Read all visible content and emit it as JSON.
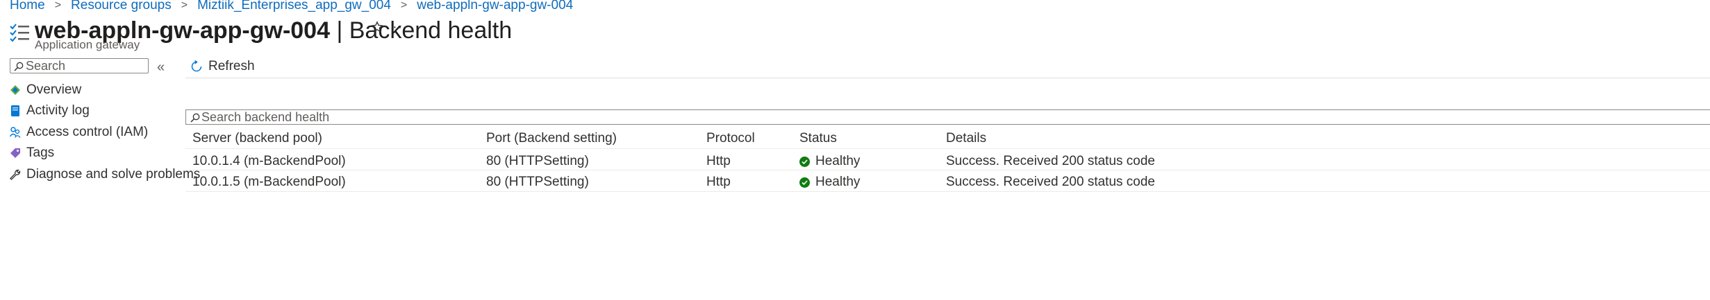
{
  "breadcrumb": {
    "items": [
      "Home",
      "Resource groups",
      "Miztiik_Enterprises_app_gw_004",
      "web-appln-gw-app-gw-004"
    ]
  },
  "header": {
    "resource_name": "web-appln-gw-app-gw-004",
    "separator": " | ",
    "blade_title": "Backend health",
    "subtitle": "Application gateway",
    "more_label": "···"
  },
  "sidebar": {
    "search_placeholder": "Search",
    "collapse_glyph": "«",
    "items": [
      {
        "label": "Overview",
        "icon": "overview-icon"
      },
      {
        "label": "Activity log",
        "icon": "activity-log-icon"
      },
      {
        "label": "Access control (IAM)",
        "icon": "iam-icon"
      },
      {
        "label": "Tags",
        "icon": "tag-icon"
      },
      {
        "label": "Diagnose and solve problems",
        "icon": "wrench-icon"
      }
    ]
  },
  "toolbar": {
    "refresh_label": "Refresh"
  },
  "backend_search": {
    "placeholder": "Search backend health"
  },
  "table": {
    "columns": [
      "Server (backend pool)",
      "Port (Backend setting)",
      "Protocol",
      "Status",
      "Details"
    ],
    "rows": [
      {
        "server": "10.0.1.4 (m-BackendPool)",
        "port": "80 (HTTPSetting)",
        "protocol": "Http",
        "status": "Healthy",
        "details": "Success. Received 200 status code"
      },
      {
        "server": "10.0.1.5 (m-BackendPool)",
        "port": "80 (HTTPSetting)",
        "protocol": "Http",
        "status": "Healthy",
        "details": "Success. Received 200 status code"
      }
    ]
  },
  "colors": {
    "link": "#0f6cbd",
    "healthy": "#107c10",
    "text": "#323130"
  }
}
